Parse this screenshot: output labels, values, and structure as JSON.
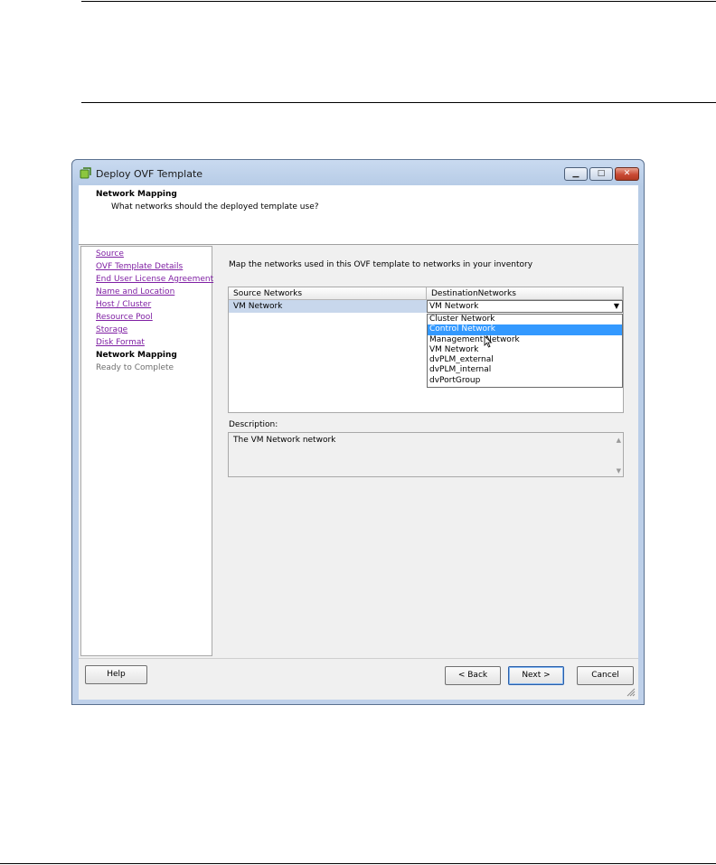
{
  "window": {
    "title": "Deploy OVF Template"
  },
  "title_controls": {
    "minimize": "▁",
    "maximize": "□",
    "close": "✕"
  },
  "header": {
    "title": "Network Mapping",
    "subtitle": "What networks should the deployed template use?"
  },
  "steps": [
    {
      "label": "Source",
      "state": "done"
    },
    {
      "label": "OVF Template Details",
      "state": "done"
    },
    {
      "label": "End User License Agreement",
      "state": "done"
    },
    {
      "label": "Name and Location",
      "state": "done"
    },
    {
      "label": "Host / Cluster",
      "state": "done"
    },
    {
      "label": "Resource Pool",
      "state": "done"
    },
    {
      "label": "Storage",
      "state": "done"
    },
    {
      "label": "Disk Format",
      "state": "done"
    },
    {
      "label": "Network Mapping",
      "state": "current"
    },
    {
      "label": "Ready to Complete",
      "state": "pending"
    }
  ],
  "main": {
    "instruction": "Map the networks used in this OVF template to networks in your inventory",
    "table": {
      "headers": [
        "Source Networks",
        "DestinationNetworks"
      ],
      "rows": [
        {
          "source": "VM Network",
          "destination": "VM Network"
        }
      ]
    },
    "dropdown": {
      "options": [
        "Cluster Network",
        "Control Network",
        "Management Network",
        "VM Network",
        "dvPLM_external",
        "dvPLM_internal",
        "dvPortGroup"
      ],
      "highlighted": "Control Network"
    },
    "description_label": "Description:",
    "description_text": "The VM Network network"
  },
  "buttons": {
    "help": "Help",
    "back": "< Back",
    "next": "Next >",
    "cancel": "Cancel"
  },
  "colors": {
    "selected_row": "#c8d7ec",
    "dropdown_highlight": "#3399ff",
    "visited_link": "#7f1fa3"
  }
}
